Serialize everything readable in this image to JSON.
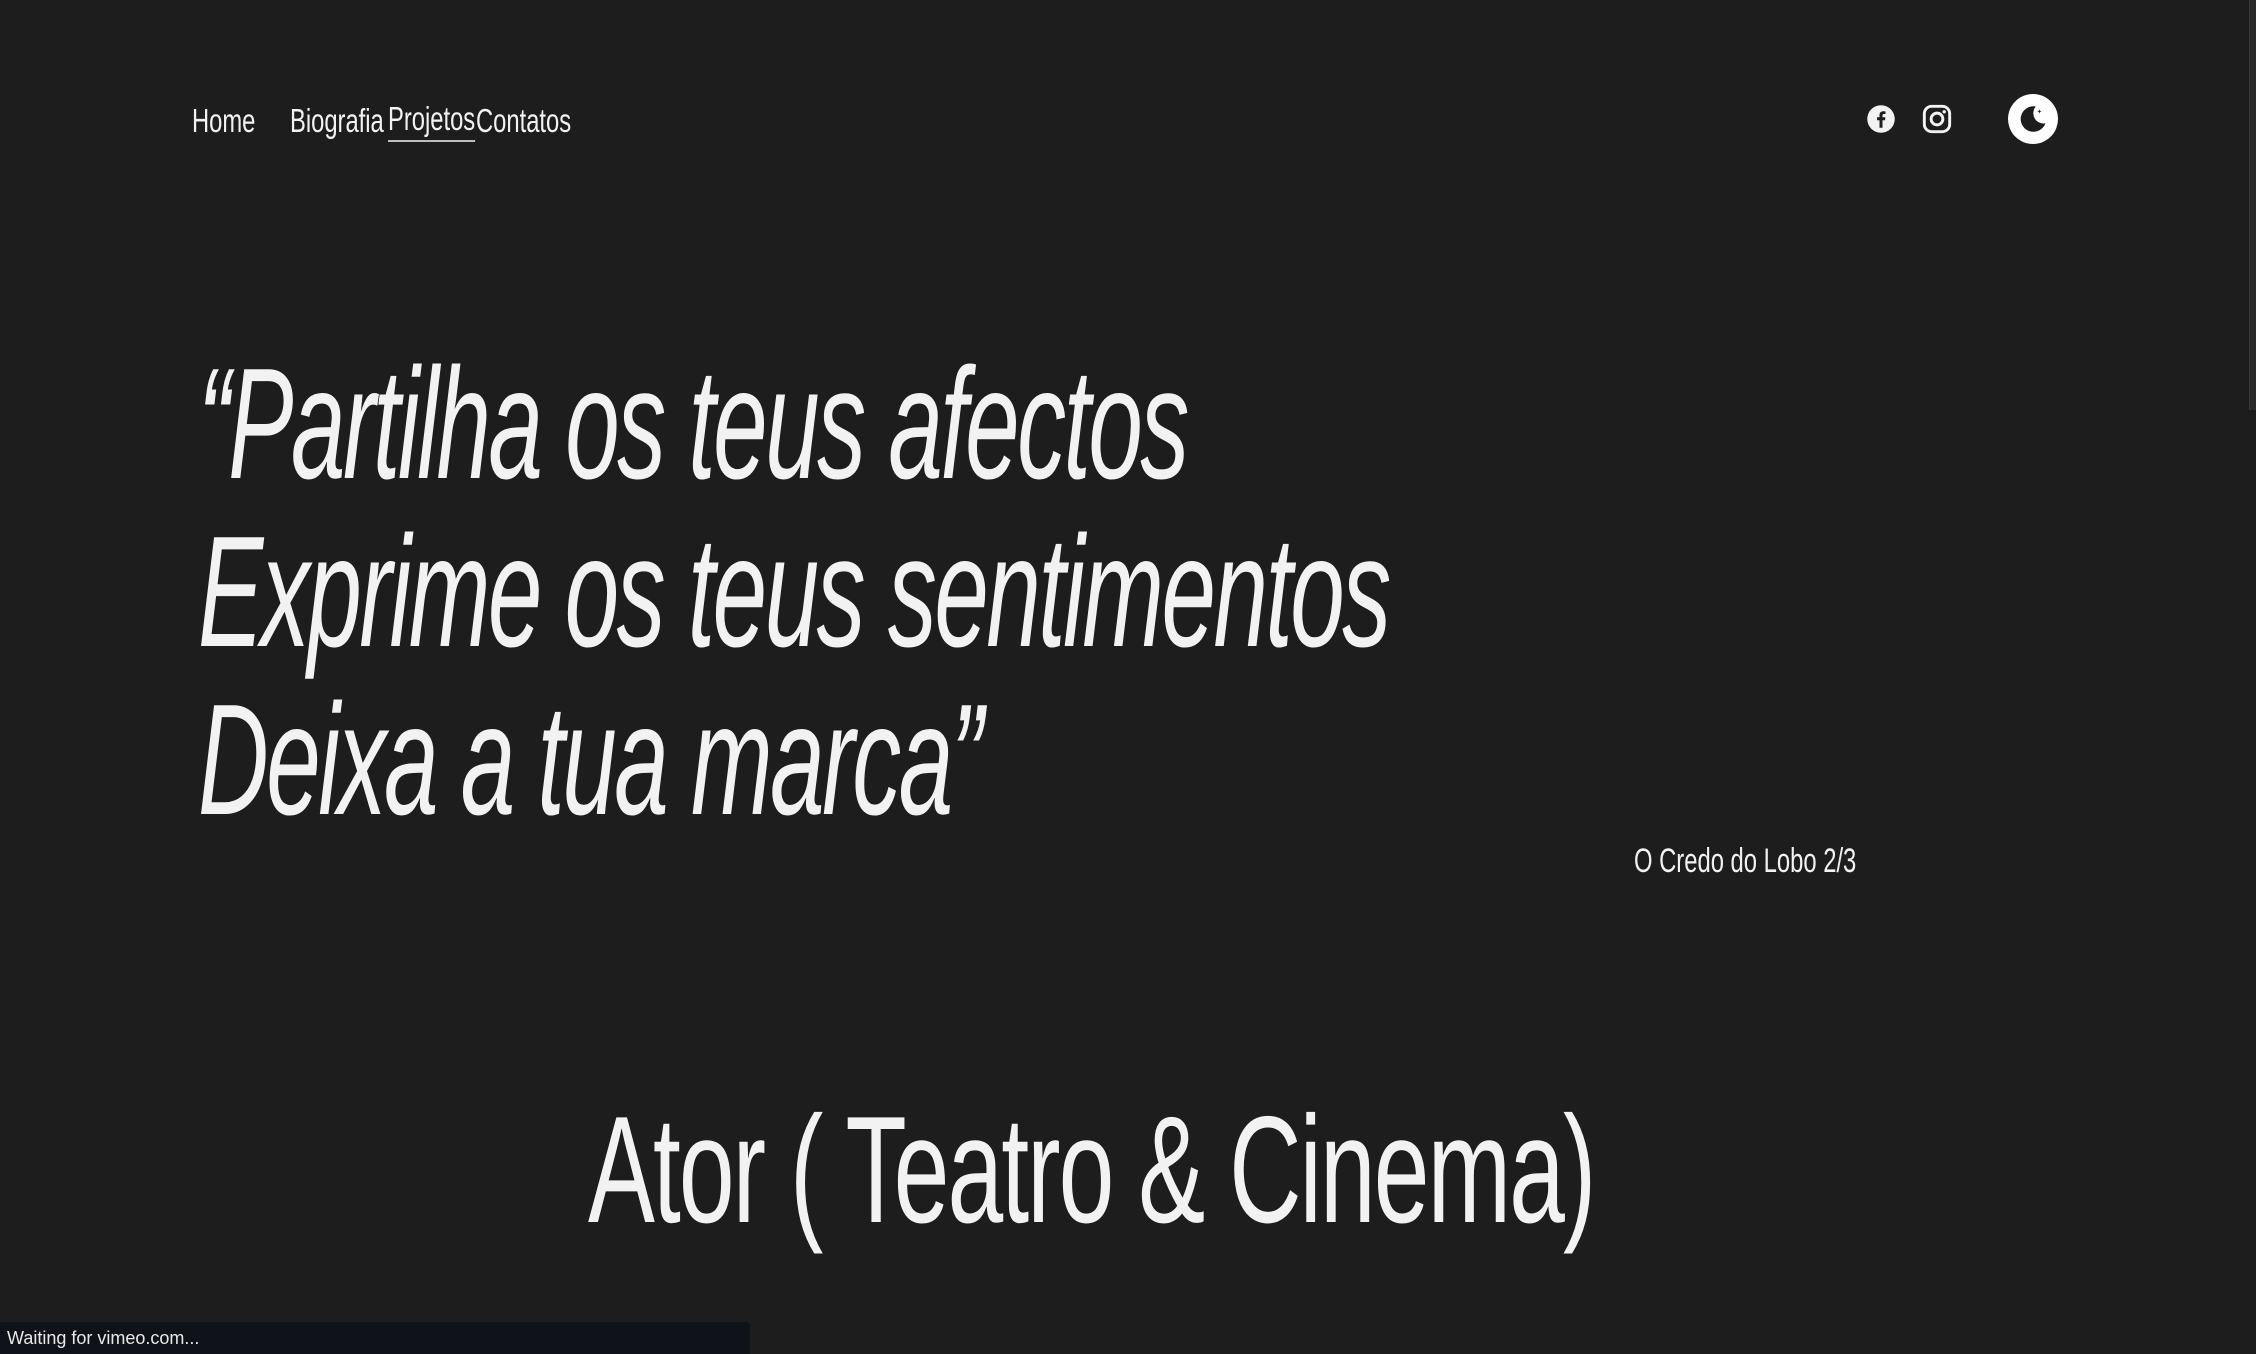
{
  "nav": {
    "items": [
      {
        "label": "Home",
        "active": false
      },
      {
        "label": "Biografia",
        "active": false
      },
      {
        "label": "Projetos",
        "active": true
      },
      {
        "label": "Contatos",
        "active": false
      }
    ]
  },
  "social": {
    "facebook_icon": "facebook-icon",
    "instagram_icon": "instagram-icon",
    "theme_icon": "moon-star-icon"
  },
  "quote": {
    "line1": "“Partilha os teus afectos",
    "line2": "Exprime os teus sentimentos",
    "line3": "Deixa a tua marca”",
    "caption": "O Credo do Lobo 2/3"
  },
  "section": {
    "title": "Ator ( Teatro & Cinema)"
  },
  "status": {
    "text": "Waiting for vimeo.com..."
  },
  "colors": {
    "background": "#1d1d1e",
    "text": "#f2f2f2",
    "status_bar": "#0f1218"
  }
}
